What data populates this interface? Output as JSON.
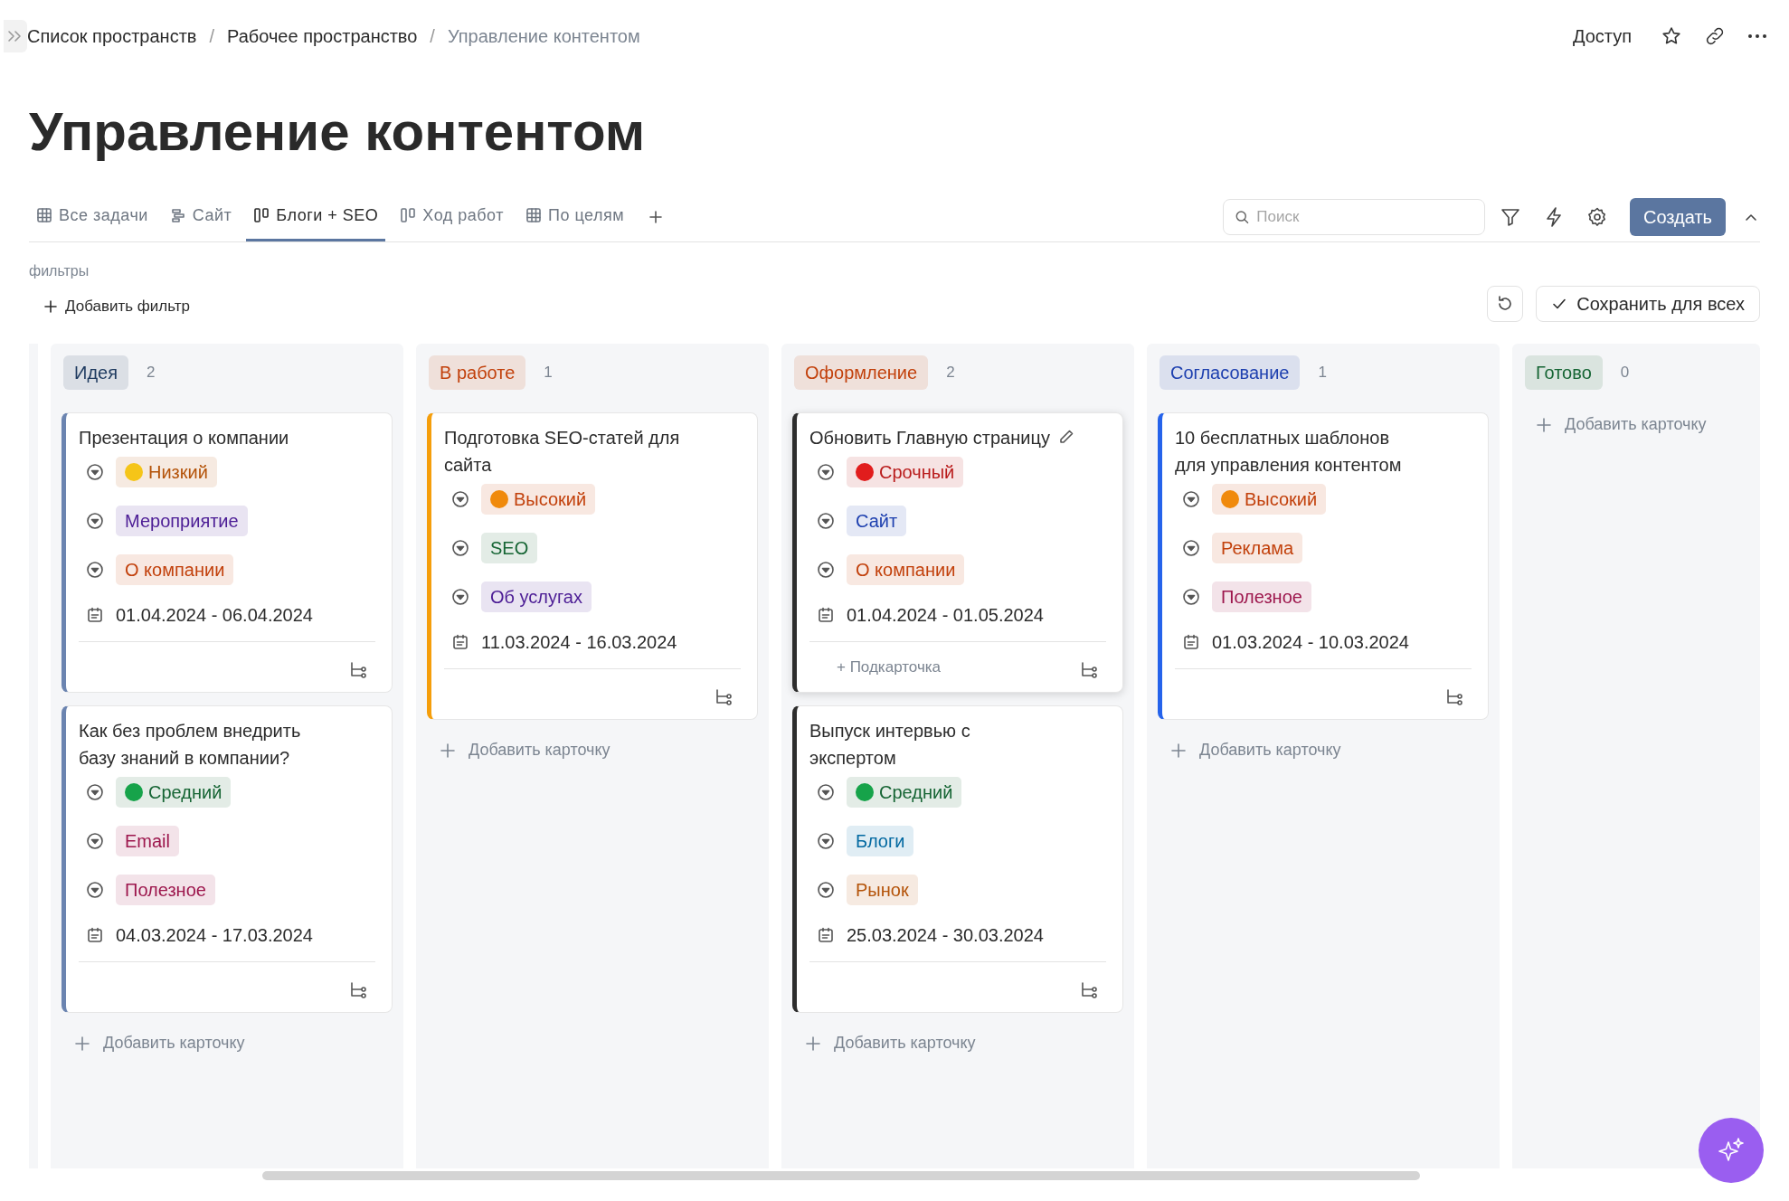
{
  "breadcrumbs": [
    {
      "label": "Список пространств",
      "current": false
    },
    {
      "label": "Рабочее пространство",
      "current": false
    },
    {
      "label": "Управление контентом",
      "current": true
    }
  ],
  "breadcrumb_separator": "/",
  "header_actions": {
    "access": "Доступ"
  },
  "title": "Управление контентом",
  "tabs": [
    {
      "label": "Все задачи",
      "kind": "table",
      "selected": false
    },
    {
      "label": "Сайт",
      "kind": "timeline",
      "selected": false
    },
    {
      "label": "Блоги + SEO",
      "kind": "board",
      "selected": true
    },
    {
      "label": "Ход работ",
      "kind": "board",
      "selected": false
    },
    {
      "label": "По целям",
      "kind": "table",
      "selected": false
    }
  ],
  "search": {
    "placeholder": "Поиск"
  },
  "create_button": "Создать",
  "filters": {
    "label": "фильтры",
    "add": "Добавить фильтр",
    "save": "Сохранить для всех"
  },
  "columns": [
    {
      "title": "Идея",
      "count": "2",
      "color": "#1e3a5f",
      "add_label": "Добавить карточку",
      "cards": [
        {
          "title": "Презентация о компании",
          "color": "#6b84b0",
          "hovered": false,
          "tags": [
            {
              "text": "Низкий",
              "color": "#b45309",
              "dot": {
                "color": "#f5c518"
              }
            },
            {
              "text": "Мероприятие",
              "color": "#4c1d95"
            },
            {
              "text": "О компании",
              "color": "#c2410c"
            }
          ],
          "dates": "01.04.2024 - 06.04.2024"
        },
        {
          "title": "Как без проблем внедрить базу знаний в компании?",
          "color": "#6b84b0",
          "hovered": false,
          "tags": [
            {
              "text": "Средний",
              "color": "#166534",
              "dot": {
                "color": "#16a34a"
              }
            },
            {
              "text": "Email",
              "color": "#9d174d"
            },
            {
              "text": "Полезное",
              "color": "#9d174d"
            }
          ],
          "dates": "04.03.2024 - 17.03.2024"
        }
      ]
    },
    {
      "title": "В работе",
      "count": "1",
      "color": "#c2410c",
      "add_label": "Добавить карточку",
      "cards": [
        {
          "title": "Подготовка SEO-статей для сайта",
          "color": "#f59e0b",
          "hovered": false,
          "tags": [
            {
              "text": "Высокий",
              "color": "#c2410c",
              "dot": {
                "color": "#f08a0c"
              }
            },
            {
              "text": "SEO",
              "color": "#166534"
            },
            {
              "text": "Об услугах",
              "color": "#4c1d95"
            }
          ],
          "dates": "11.03.2024 - 16.03.2024"
        }
      ]
    },
    {
      "title": "Оформление",
      "count": "2",
      "color": "#c2410c",
      "add_label": "Добавить карточку",
      "cards": [
        {
          "title": "Обновить Главную страницу",
          "color": "#2d2d2d",
          "hovered": true,
          "subcard_label": "+ Подкарточка",
          "tags": [
            {
              "text": "Срочный",
              "color": "#b91c1c",
              "dot": {
                "color": "#e11d1d"
              }
            },
            {
              "text": "Сайт",
              "color": "#1e40af"
            },
            {
              "text": "О компании",
              "color": "#c2410c"
            }
          ],
          "dates": "01.04.2024 - 01.05.2024"
        },
        {
          "title": "Выпуск интервью с экспертом",
          "color": "#2d2d2d",
          "hovered": false,
          "tags": [
            {
              "text": "Средний",
              "color": "#166534",
              "dot": {
                "color": "#16a34a"
              }
            },
            {
              "text": "Блоги",
              "color": "#0369a1"
            },
            {
              "text": "Рынок",
              "color": "#b45309"
            }
          ],
          "dates": "25.03.2024 - 30.03.2024"
        }
      ]
    },
    {
      "title": "Согласование",
      "count": "1",
      "color": "#1e40af",
      "add_label": "Добавить карточку",
      "cards": [
        {
          "title": "10 бесплатных шаблонов для управления контентом",
          "color": "#2563eb",
          "hovered": false,
          "tags": [
            {
              "text": "Высокий",
              "color": "#c2410c",
              "dot": {
                "color": "#f08a0c"
              }
            },
            {
              "text": "Реклама",
              "color": "#c2410c"
            },
            {
              "text": "Полезное",
              "color": "#9d174d"
            }
          ],
          "dates": "01.03.2024 - 10.03.2024"
        }
      ]
    },
    {
      "title": "Готово",
      "count": "0",
      "color": "#166534",
      "add_label": "Добавить карточку"
    }
  ]
}
